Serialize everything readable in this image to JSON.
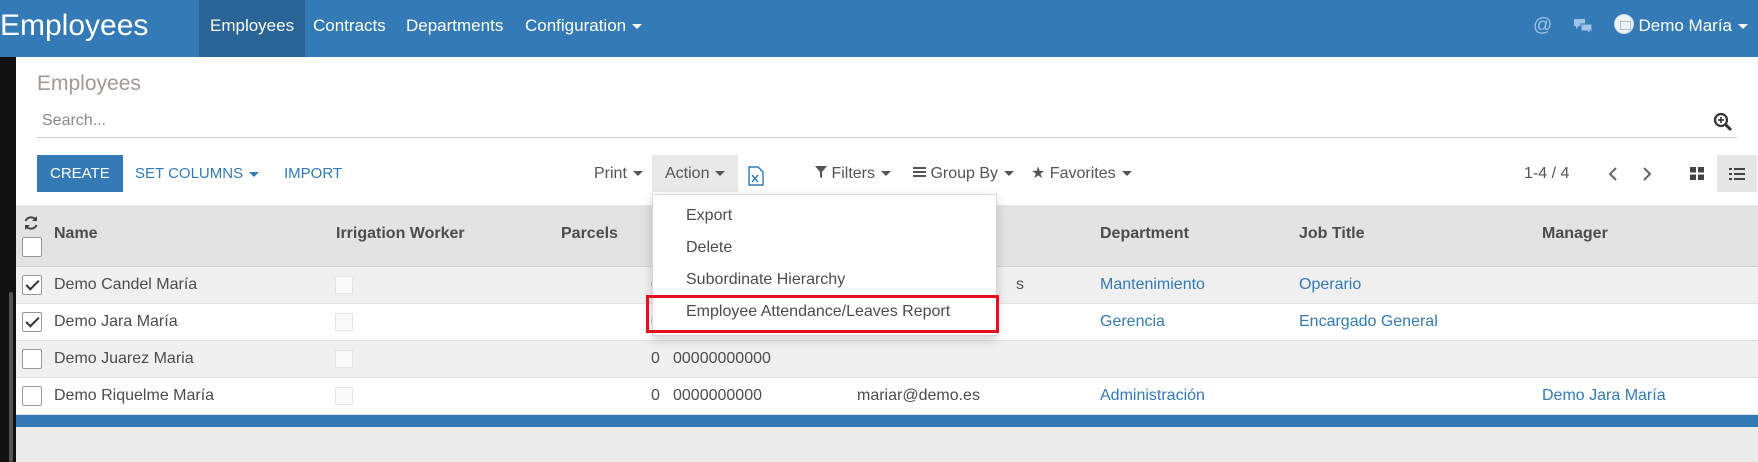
{
  "app": {
    "brand": "Employees",
    "nav": [
      {
        "label": "Employees",
        "active": true
      },
      {
        "label": "Contracts",
        "active": false
      },
      {
        "label": "Departments",
        "active": false
      },
      {
        "label": "Configuration",
        "active": false,
        "has_caret": true
      }
    ],
    "icons": [
      "at-icon",
      "chat-icon"
    ],
    "user": {
      "name": "Demo María",
      "icon": "avatar"
    }
  },
  "control_panel": {
    "breadcrumb": "Employees",
    "search": {
      "placeholder": "Search...",
      "value": ""
    },
    "buttons": {
      "create": "CREATE",
      "set_columns": "SET COLUMNS",
      "import": "IMPORT"
    },
    "toolbar": {
      "print": "Print",
      "action": "Action",
      "filters": "Filters",
      "group_by": "Group By",
      "favorites": "Favorites"
    },
    "pager": {
      "text": "1-4 / 4"
    }
  },
  "table": {
    "columns": [
      "Name",
      "Irrigation Worker",
      "Parcels",
      "",
      "",
      "Department",
      "Job Title",
      "Manager"
    ],
    "rows": [
      {
        "checked": true,
        "name": "Demo Candel María",
        "parcels": "0",
        "phone": "",
        "email": "s",
        "department": "Mantenimiento",
        "job_title": "Operario",
        "manager": ""
      },
      {
        "checked": true,
        "name": "Demo Jara María",
        "parcels": "0",
        "phone": "",
        "email": "",
        "department": "Gerencia",
        "job_title": "Encargado General",
        "manager": ""
      },
      {
        "checked": false,
        "name": "Demo Juarez Maria",
        "parcels": "0",
        "phone": "00000000000",
        "email": "",
        "department": "",
        "job_title": "",
        "manager": ""
      },
      {
        "checked": false,
        "name": "Demo Riquelme María",
        "parcels": "0",
        "phone": "0000000000",
        "email": "mariar@demo.es",
        "department": "Administración",
        "job_title": "",
        "manager": "Demo Jara María"
      }
    ]
  },
  "action_menu": {
    "items": [
      "Export",
      "Delete",
      "Subordinate Hierarchy",
      "Employee Attendance/Leaves Report"
    ],
    "highlighted_index": 3,
    "highlight_color": "#e3101e"
  },
  "colors": {
    "primary": "#337ab7",
    "nav_active": "#2a6395",
    "text": "#4c4c4c"
  }
}
